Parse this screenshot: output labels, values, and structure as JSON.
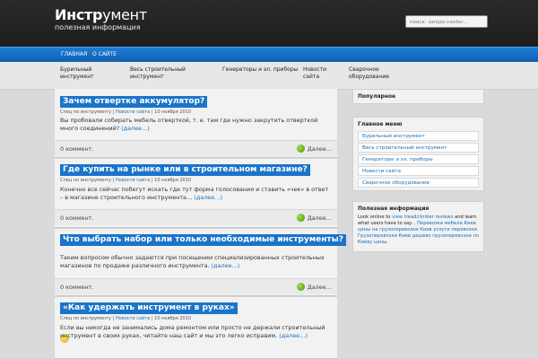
{
  "header": {
    "logo_part1": "Инстр",
    "logo_part2": "умент",
    "tagline": "полезная информация",
    "search_placeholder": "поиск: запрос+enter..."
  },
  "nav": {
    "items": [
      "ГЛАВНАЯ",
      "О САЙТЕ"
    ]
  },
  "categories": [
    [
      "Бурильный",
      "инструмент"
    ],
    [
      "Весь строительный",
      "инструмент"
    ],
    [
      "Генераторы и эл. приборы",
      ""
    ],
    [
      "Новости",
      "сайта"
    ],
    [
      "Сварочное",
      "оборудование"
    ]
  ],
  "posts": [
    {
      "title": "Зачем отвертке аккумулятор?",
      "meta_cat": "Спец по инструменту",
      "meta_sep": "|",
      "meta_news": "Новости сайта",
      "meta_date": "| 10 ноября 2010",
      "excerpt": "Вы пробовали собирать мебель отверткой, т. е. там где нужно закрутить отверткой много соединений?",
      "more_link": "(далее…)",
      "comments": "0 коммент.",
      "more": "Далее…"
    },
    {
      "title": "Где купить на рынке или в строительном магазине?",
      "meta_cat": "Спец по инструменту",
      "meta_sep": "|",
      "meta_news": "Новости сайта",
      "meta_date": "| 10 ноября 2010",
      "excerpt": "Конечно все сейчас побегут искать где тут форма голосования и ставить «чек» в ответ – в магазине строительного инструмента…",
      "more_link": "(далее…)",
      "comments": "0 коммент.",
      "more": "Далее…"
    },
    {
      "title": "Что выбрать набор или только необходимые инструменты?",
      "meta_cat": "Спец по инструменту",
      "meta_sep": "|",
      "meta_news": "Новости сайта",
      "meta_date": "| 10 ноября 2010",
      "excerpt": "Таким вопросом обычно задаются при посещении специализированных строительных магазинов по продаже различного инструмента.",
      "more_link": "(далее…)",
      "comments": "0 коммент.",
      "more": "Далее…"
    },
    {
      "title": "«Как удержать инструмент в руках»",
      "meta_cat": "Спец по инструменту",
      "meta_sep": "|",
      "meta_news": "Новости сайта",
      "meta_date": "| 10 ноября 2010",
      "excerpt": "Если вы никогда не занимались дома ремонтом или просто не держали строительный инструмент в своих руках, читайте наш сайт и мы это легко исправим.",
      "more_link": "(далее…)"
    }
  ],
  "sidebar": {
    "popular_title": "Популярное",
    "menu_title": "Главное меню",
    "menu_items": [
      "Бурильный инструмент",
      "Весь строительный инструмент",
      "Генераторы и эл. приборы",
      "Новости сайта",
      "Сварочное оборудование"
    ],
    "info_title": "Полезная информация",
    "info_text_1": "Look online to ",
    "info_link_1": "view treadclimber reviews",
    "info_text_2": " and learn what users have to say. . ",
    "info_link_2": "Перевозка мебели Киев цены на грузоперевозки Киев услуги перевозки.",
    "info_link_3": " Грузоперевозки Киев дешево грузоперевозки по Киеву цены."
  },
  "colors": {
    "accent": "#1a74c9",
    "header_bg": "#222222",
    "link": "#1a6fb7"
  }
}
